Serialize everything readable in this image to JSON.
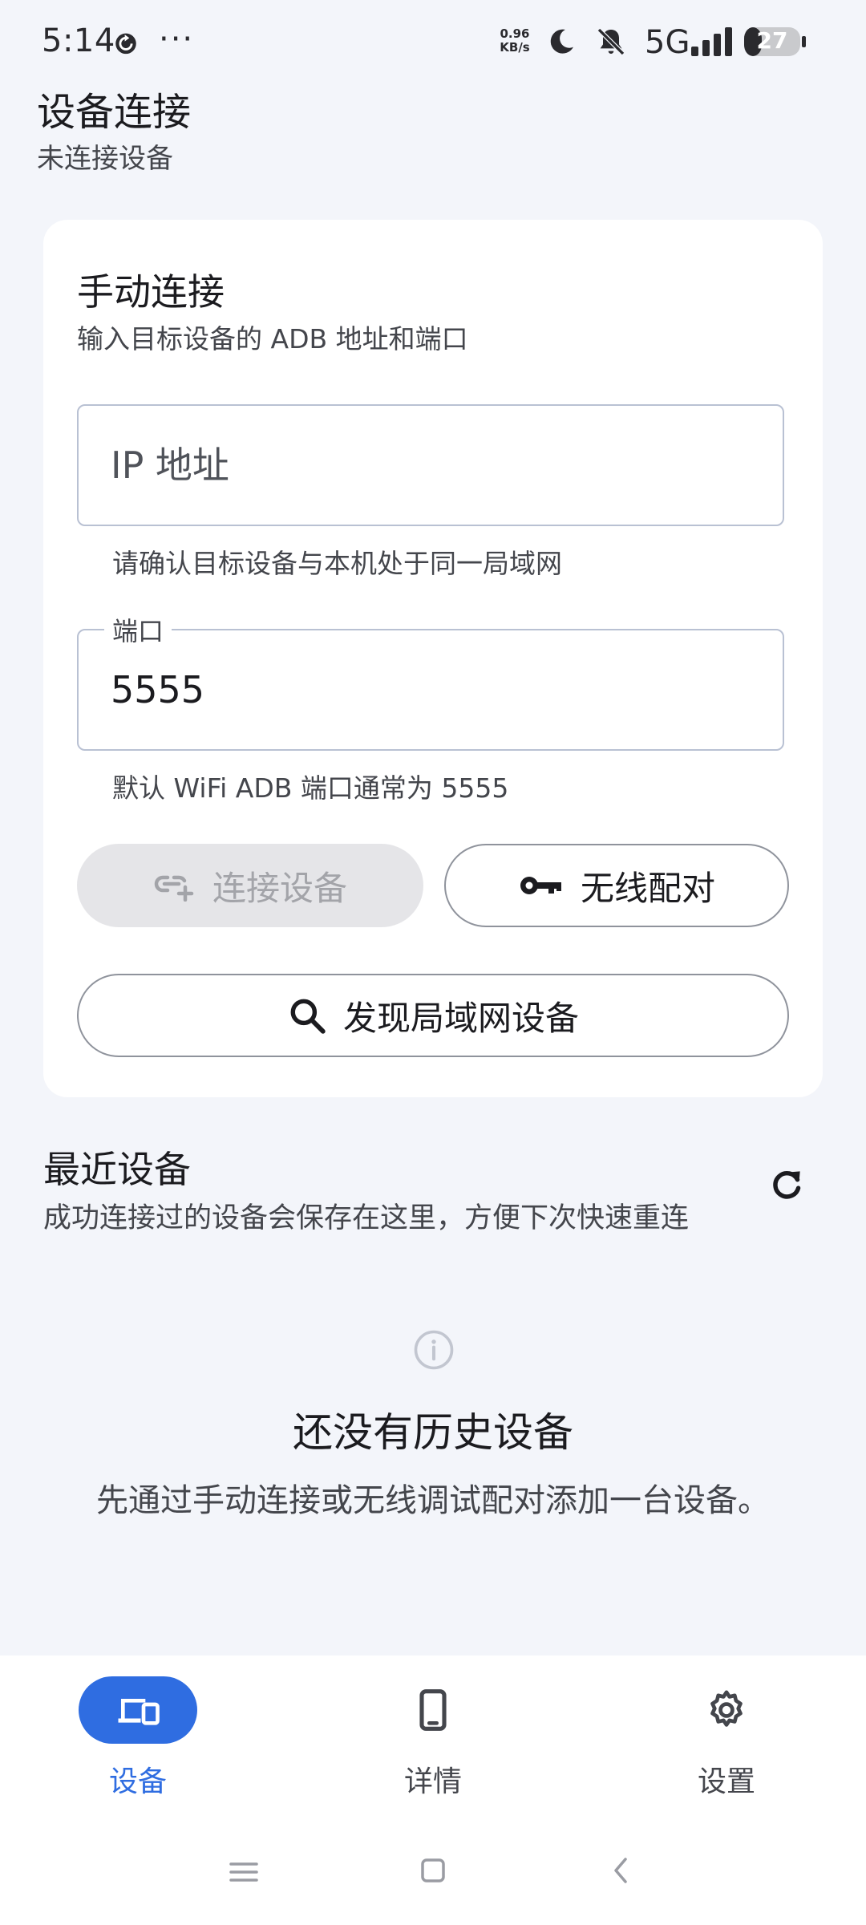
{
  "status_bar": {
    "time": "5:14",
    "more": "···",
    "net_speed_value": "0.96",
    "net_speed_unit": "KB/s",
    "network": "5G",
    "battery": "27"
  },
  "header": {
    "title": "设备连接",
    "subtitle": "未连接设备"
  },
  "manual": {
    "title": "手动连接",
    "subtitle": "输入目标设备的 ADB 地址和端口",
    "ip_placeholder": "IP 地址",
    "ip_value": "",
    "ip_help": "请确认目标设备与本机处于同一局域网",
    "port_label": "端口",
    "port_value": "5555",
    "port_help": "默认 WiFi ADB 端口通常为 5555",
    "connect_label": "连接设备",
    "pair_label": "无线配对",
    "discover_label": "发现局域网设备"
  },
  "recent": {
    "title": "最近设备",
    "subtitle": "成功连接过的设备会保存在这里，方便下次快速重连",
    "empty_title": "还没有历史设备",
    "empty_desc": "先通过手动连接或无线调试配对添加一台设备。"
  },
  "nav": {
    "items": [
      {
        "label": "设备",
        "icon": "devices-icon",
        "active": true
      },
      {
        "label": "详情",
        "icon": "phone-icon",
        "active": false
      },
      {
        "label": "设置",
        "icon": "gear-icon",
        "active": false
      }
    ]
  },
  "colors": {
    "accent": "#2f6de1",
    "background": "#f3f5fa",
    "card": "#ffffff",
    "disabled_button": "#e5e5e8"
  }
}
